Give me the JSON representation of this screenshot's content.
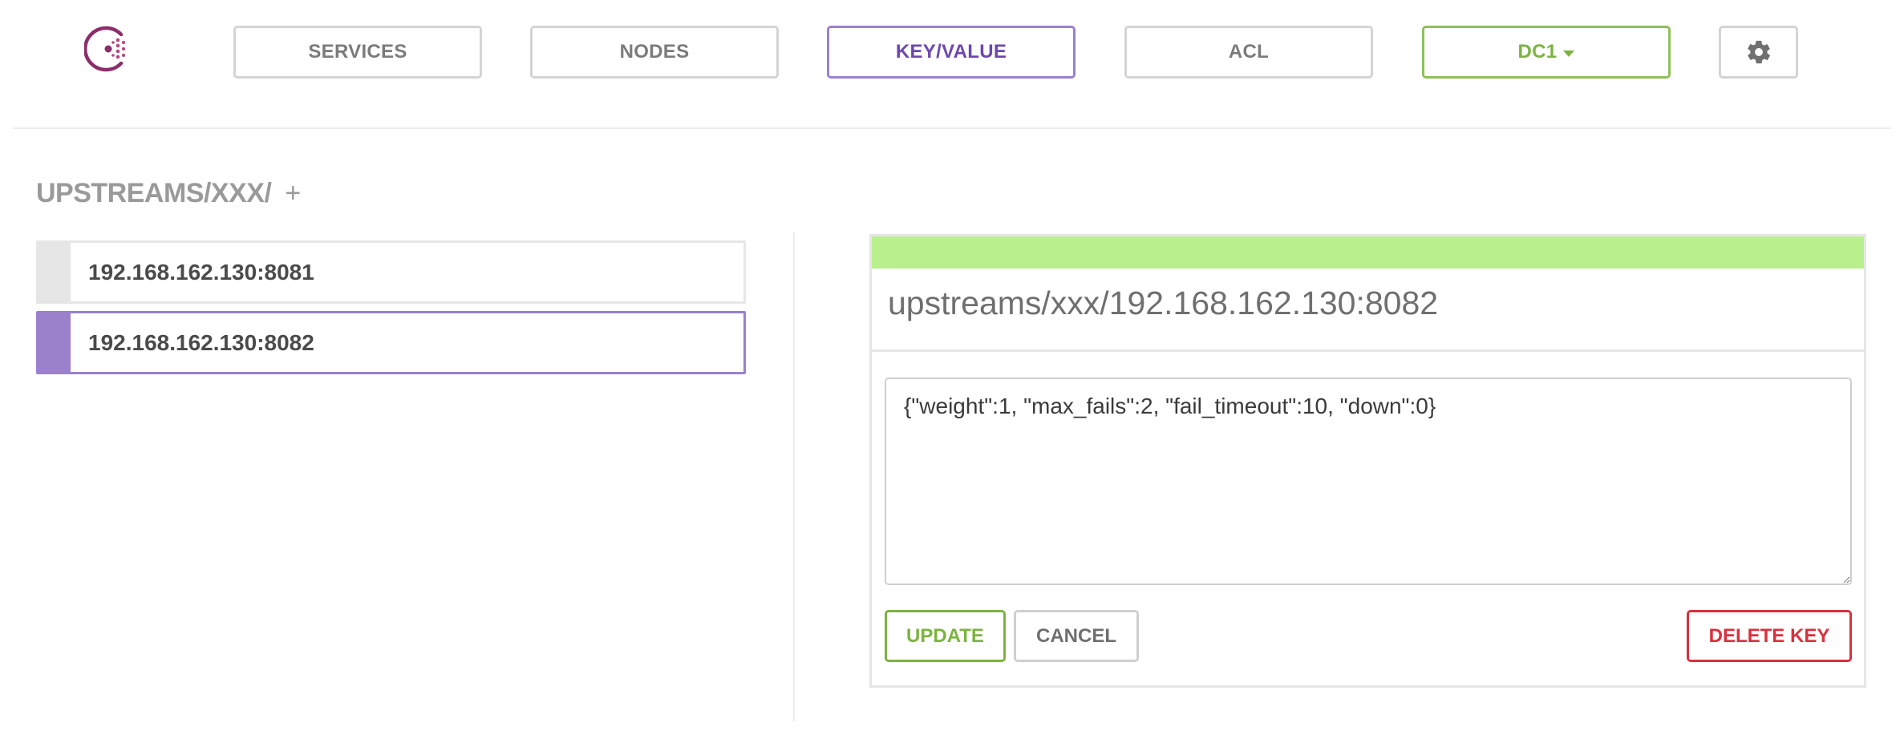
{
  "nav": {
    "services": "SERVICES",
    "nodes": "NODES",
    "key_value": "KEY/VALUE",
    "acl": "ACL",
    "datacenter": "DC1",
    "settings_icon": "gear-icon"
  },
  "breadcrumb": {
    "path": "UPSTREAMS/XXX/",
    "add": "+"
  },
  "keys": [
    {
      "label": "192.168.162.130:8081",
      "selected": false
    },
    {
      "label": "192.168.162.130:8082",
      "selected": true
    }
  ],
  "editor": {
    "title": "upstreams/xxx/192.168.162.130:8082",
    "value": "{\"weight\":1, \"max_fails\":2, \"fail_timeout\":10, \"down\":0}",
    "update_label": "UPDATE",
    "cancel_label": "CANCEL",
    "delete_label": "DELETE KEY"
  },
  "colors": {
    "accent_purple": "#9b80cc",
    "accent_green": "#7cb342",
    "status_bar": "#b9f08d",
    "danger": "#d9303e"
  }
}
